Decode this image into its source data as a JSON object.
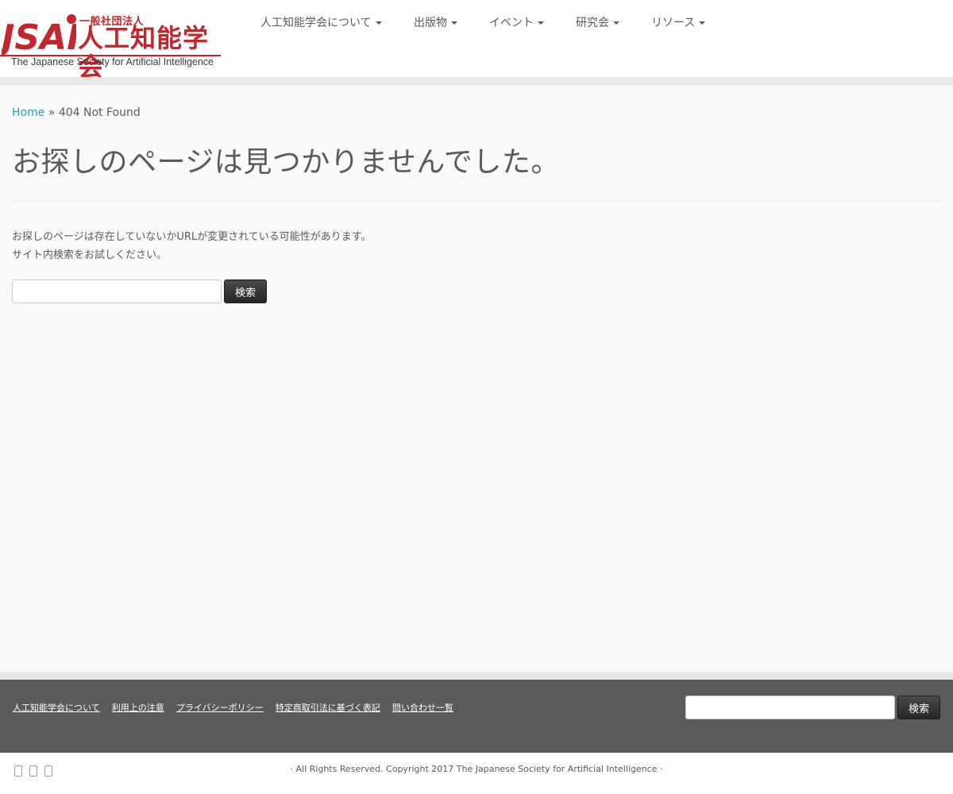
{
  "logo": {
    "mark_text": "JSAI",
    "small_text": "一般社団法人",
    "big_text": "人工知能学会",
    "english_text": "The Japanese Society for Artificial Intelligence",
    "brand_color": "#c1272d"
  },
  "nav": {
    "items": [
      {
        "label": "人工知能学会について"
      },
      {
        "label": "出版物"
      },
      {
        "label": "イベント"
      },
      {
        "label": "研究会"
      },
      {
        "label": "リソース"
      }
    ]
  },
  "breadcrumb": {
    "home": "Home",
    "separator": "»",
    "current": "404 Not Found"
  },
  "main": {
    "title": "お探しのページは見つかりませんでした。",
    "message_line1": "お探しのページは存在していないかURLが変更されている可能性があります。",
    "message_line2": "サイト内検索をお試しください。",
    "search_button": "検索",
    "search_value": ""
  },
  "footer": {
    "links": [
      {
        "label": "人工知能学会について"
      },
      {
        "label": "利用上の注意"
      },
      {
        "label": "プライバシーポリシー"
      },
      {
        "label": "特定商取引法に基づく表記"
      },
      {
        "label": "問い合わせ一覧"
      }
    ],
    "search_button": "検索"
  },
  "bottom": {
    "copyright": "· All Rights Reserved. Copyright 2017 The Japanese Society for Artificial Intelligence ·",
    "social_icons": [
      "social-icon-1",
      "social-icon-2",
      "social-icon-3"
    ]
  },
  "colors": {
    "accent_link": "#27a0c9",
    "footer_bg": "#5a5a5a",
    "page_bg": "#f9f9f9"
  }
}
